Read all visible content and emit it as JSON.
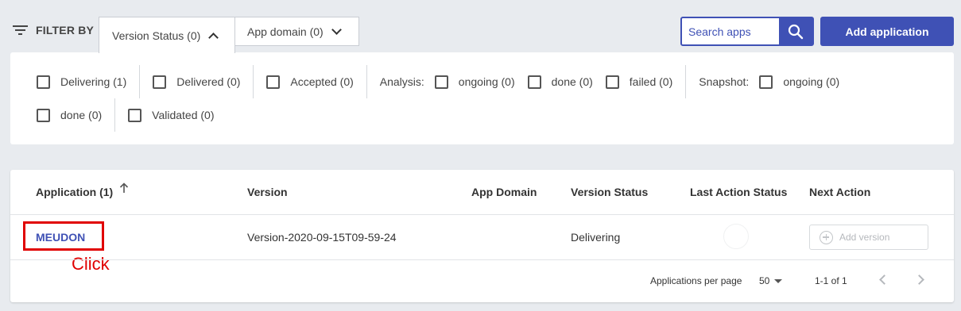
{
  "filter": {
    "label": "FILTER BY",
    "tabs": [
      {
        "label": "Version Status (0)"
      },
      {
        "label": "App domain (0)"
      }
    ]
  },
  "search": {
    "placeholder": "Search apps"
  },
  "add_application": "Add application",
  "status_filters": {
    "row1": [
      "Delivering (1)",
      "Delivered (0)",
      "Accepted (0)"
    ],
    "analysis_label": "Analysis:",
    "analysis": [
      "ongoing (0)",
      "done (0)",
      "failed (0)"
    ],
    "snapshot_label": "Snapshot:",
    "snapshot": [
      "ongoing (0)",
      "done (0)"
    ],
    "validated": "Validated (0)"
  },
  "table": {
    "headers": {
      "application": "Application (1)",
      "version": "Version",
      "app_domain": "App Domain",
      "version_status": "Version Status",
      "last_action_status": "Last Action Status",
      "next_action": "Next Action"
    },
    "rows": [
      {
        "application": "MEUDON",
        "version": "Version-2020-09-15T09-59-24",
        "app_domain": "",
        "version_status": "Delivering",
        "next_action": "Add version"
      }
    ],
    "annotation": "Click",
    "footer": {
      "per_page_label": "Applications per page",
      "per_page_value": "50",
      "range": "1-1 of 1"
    }
  },
  "colors": {
    "accent": "#3f51b5",
    "annotation": "#e00000"
  }
}
